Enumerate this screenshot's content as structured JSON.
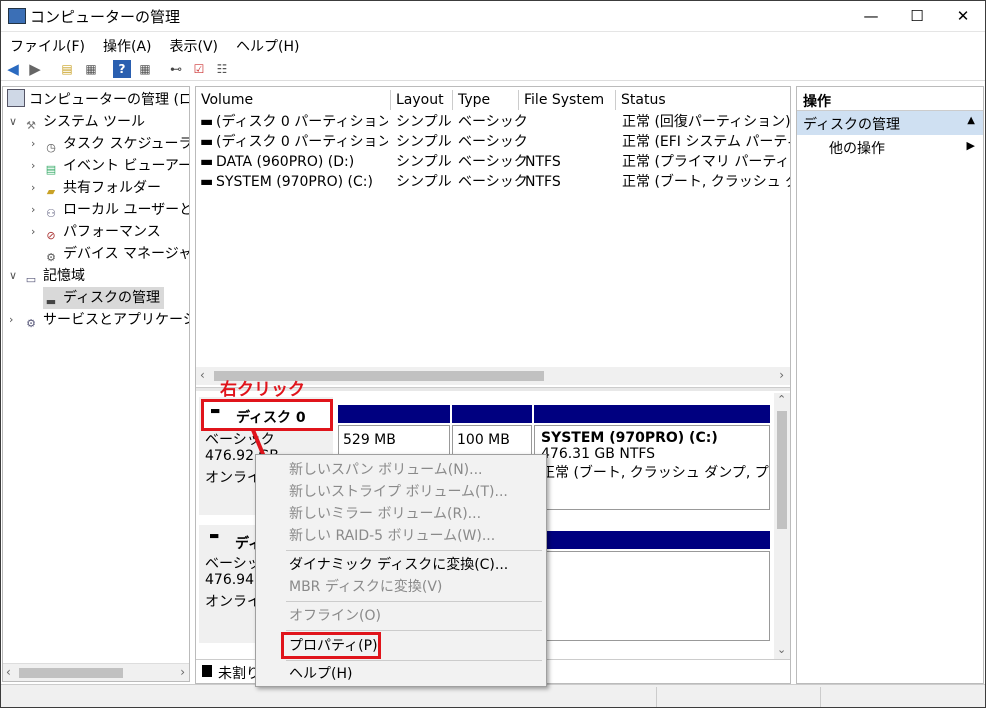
{
  "window": {
    "title": "コンピューターの管理",
    "controls": {
      "minimize": "—",
      "maximize": "☐",
      "close": "✕"
    }
  },
  "menu": [
    "ファイル(F)",
    "操作(A)",
    "表示(V)",
    "ヘルプ(H)"
  ],
  "tree": {
    "items": [
      {
        "label": "コンピューターの管理 (ローカ"
      },
      {
        "label": "システム ツール"
      },
      {
        "label": "タスク スケジューラ"
      },
      {
        "label": "イベント ビューアー"
      },
      {
        "label": "共有フォルダー"
      },
      {
        "label": "ローカル ユーザーとグル"
      },
      {
        "label": "パフォーマンス"
      },
      {
        "label": "デバイス マネージャー"
      },
      {
        "label": "記憶域"
      },
      {
        "label": "ディスクの管理"
      },
      {
        "label": "サービスとアプリケーション"
      }
    ]
  },
  "volumes": {
    "headers": [
      "Volume",
      "Layout",
      "Type",
      "File System",
      "Status"
    ],
    "rows": [
      {
        "volume": "(ディスク 0 パーティション 1)",
        "layout": "シンプル",
        "type": "ベーシック",
        "fs": "",
        "status": "正常 (回復パーティション)"
      },
      {
        "volume": "(ディスク 0 パーティション 2)",
        "layout": "シンプル",
        "type": "ベーシック",
        "fs": "",
        "status": "正常 (EFI システム パーティ"
      },
      {
        "volume": "DATA (960PRO) (D:)",
        "layout": "シンプル",
        "type": "ベーシック",
        "fs": "NTFS",
        "status": "正常 (プライマリ パーティション"
      },
      {
        "volume": "SYSTEM (970PRO) (C:)",
        "layout": "シンプル",
        "type": "ベーシック",
        "fs": "NTFS",
        "status": "正常 (ブート, クラッシュ ダン"
      }
    ]
  },
  "annotation": "右クリック",
  "disk0": {
    "name": "ディスク 0",
    "type": "ベーシック",
    "size": "476.92 GB",
    "state": "オンライン",
    "part1_size": "529 MB",
    "part2_size": "100 MB",
    "system_name": "SYSTEM (970PRO)  (C:)",
    "system_size": "476.31 GB NTFS",
    "system_status": "正常 (ブート, クラッシュ ダンプ, プライマ"
  },
  "disk1": {
    "name": "ディ",
    "type": "ベーシッ",
    "size": "476.94",
    "state": "オンライン"
  },
  "legend": {
    "unallocated": "未割り"
  },
  "actions": {
    "header": "操作",
    "section": "ディスクの管理",
    "other": "他の操作"
  },
  "context_menu": {
    "items": [
      {
        "label": "新しいスパン ボリューム(N)...",
        "enabled": false
      },
      {
        "label": "新しいストライプ ボリューム(T)...",
        "enabled": false
      },
      {
        "label": "新しいミラー ボリューム(R)...",
        "enabled": false
      },
      {
        "label": "新しい RAID-5 ボリューム(W)...",
        "enabled": false
      },
      {
        "label": "ダイナミック ディスクに変換(C)...",
        "enabled": true
      },
      {
        "label": "MBR ディスクに変換(V)",
        "enabled": false
      },
      {
        "label": "オフライン(O)",
        "enabled": false
      },
      {
        "label": "プロパティ(P)",
        "enabled": true
      },
      {
        "label": "ヘルプ(H)",
        "enabled": true
      }
    ]
  },
  "colors": {
    "accent_blue": "#000080",
    "highlight_red": "#e0141b",
    "selection": "#cce8ff"
  }
}
